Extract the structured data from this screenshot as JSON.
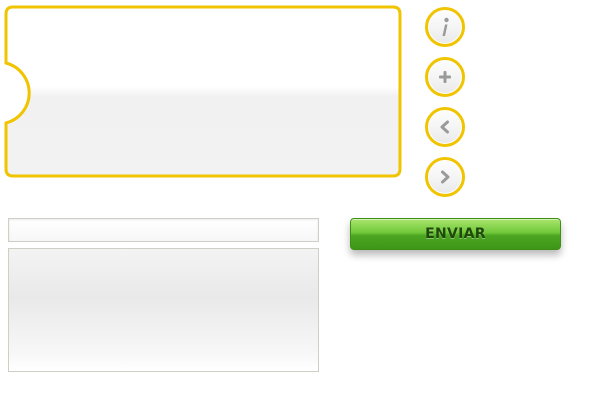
{
  "panel": {
    "border_color": "#f0c400"
  },
  "icons": [
    {
      "name": "info-icon",
      "glyph": "i"
    },
    {
      "name": "plus-icon",
      "glyph": "+"
    },
    {
      "name": "chevron-left-icon",
      "glyph": "<"
    },
    {
      "name": "chevron-right-icon",
      "glyph": ">"
    }
  ],
  "form": {
    "input_value": "",
    "textarea_value": "",
    "submit_label": "ENVIAR",
    "submit_color": "#4da622"
  }
}
